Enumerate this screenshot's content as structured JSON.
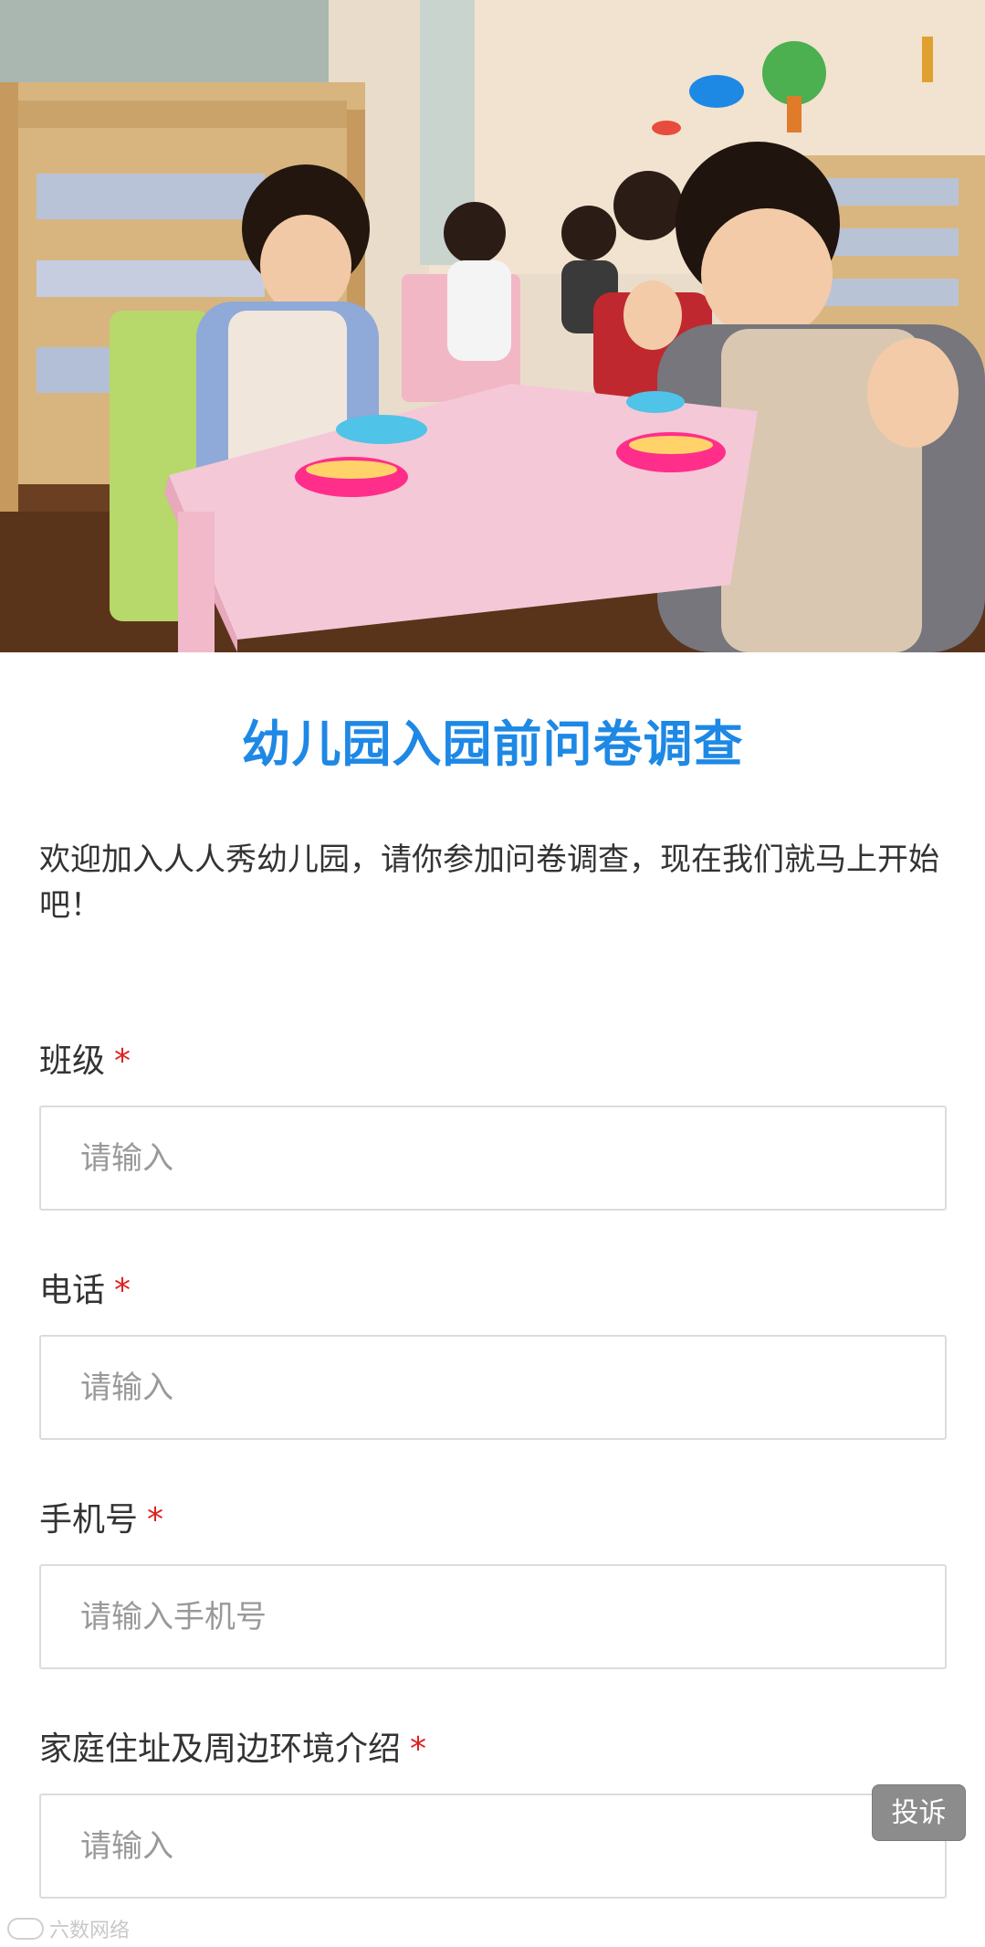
{
  "hero": {
    "image_subject": "kindergarten-children-at-pink-table"
  },
  "form": {
    "title": "幼儿园入园前问卷调查",
    "intro": "欢迎加入人人秀幼儿园，请你参加问卷调查，现在我们就马上开始吧！",
    "required_mark": "*",
    "fields": [
      {
        "label": "班级",
        "placeholder": "请输入",
        "value": ""
      },
      {
        "label": "电话",
        "placeholder": "请输入",
        "value": ""
      },
      {
        "label": "手机号",
        "placeholder": "请输入手机号",
        "value": ""
      },
      {
        "label": "家庭住址及周边环境介绍",
        "placeholder": "请输入",
        "value": ""
      }
    ]
  },
  "complain_button": {
    "label": "投诉"
  },
  "watermark": {
    "text": "六数网络",
    "icon": "brand-logo-icon"
  },
  "colors": {
    "title": "#1e88e5",
    "required": "#e02020",
    "input_border": "#dcdcdc",
    "placeholder": "#999999",
    "complain_bg": "#8c8c8c"
  }
}
